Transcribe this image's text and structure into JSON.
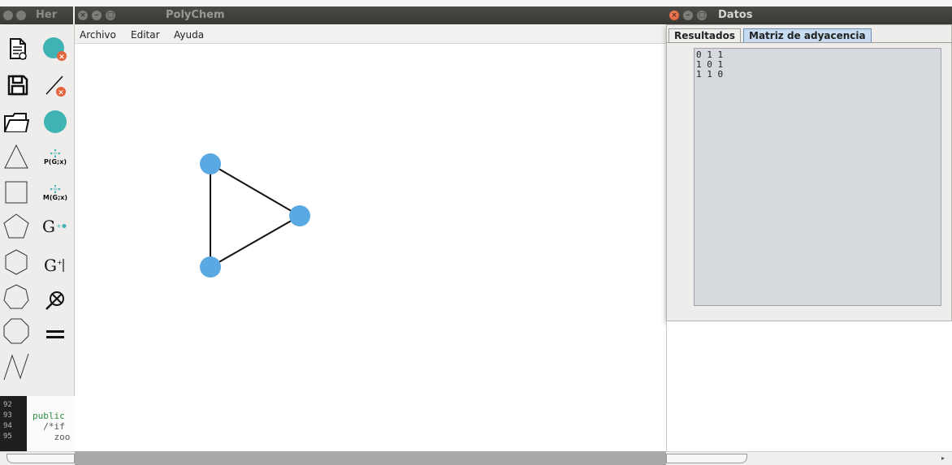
{
  "background_window": {
    "title": "Her"
  },
  "main_window": {
    "title": "PolyChem",
    "menu": [
      "Archivo",
      "Editar",
      "Ayuda"
    ]
  },
  "palette": {
    "tools": [
      {
        "name": "new-file-icon"
      },
      {
        "name": "delete-vertex-icon"
      },
      {
        "name": "save-icon"
      },
      {
        "name": "delete-edge-icon"
      },
      {
        "name": "open-folder-icon"
      },
      {
        "name": "add-vertex-icon"
      },
      {
        "name": "triangle-icon"
      },
      {
        "name": "polynomial-icon",
        "label": "P(G;x)"
      },
      {
        "name": "square-icon"
      },
      {
        "name": "matching-icon",
        "label": "M(G;x)"
      },
      {
        "name": "pentagon-icon"
      },
      {
        "name": "graph-add-vertex-icon",
        "label": "G"
      },
      {
        "name": "hexagon-icon"
      },
      {
        "name": "graph-add-edge-icon",
        "label": "G"
      },
      {
        "name": "heptagon-icon"
      },
      {
        "name": "zoom-tensor-icon"
      },
      {
        "name": "octagon-icon"
      },
      {
        "name": "equals-icon"
      },
      {
        "name": "path-icon"
      }
    ]
  },
  "code": {
    "lines": [
      {
        "num": "92",
        "text": ""
      },
      {
        "num": "93",
        "text": "public"
      },
      {
        "num": "94",
        "text": "  /*if"
      },
      {
        "num": "95",
        "text": "    zoo"
      }
    ]
  },
  "graph": {
    "vertex_color": "#5aa9e2",
    "edge_color": "#111111",
    "vertices": [
      {
        "id": "v1"
      },
      {
        "id": "v2"
      },
      {
        "id": "v3"
      }
    ],
    "edges": [
      [
        "v1",
        "v2"
      ],
      [
        "v2",
        "v3"
      ],
      [
        "v3",
        "v1"
      ]
    ]
  },
  "datos_window": {
    "title": "Datos",
    "tabs": [
      "Resultados",
      "Matriz de adyacencia"
    ],
    "active_tab": 1,
    "matrix": [
      "0 1 1",
      "1 0 1",
      "1 1 0"
    ]
  },
  "colors": {
    "accent": "#c7dcf0",
    "close_button": "#e2643a",
    "teal": "#3fb3b3"
  }
}
